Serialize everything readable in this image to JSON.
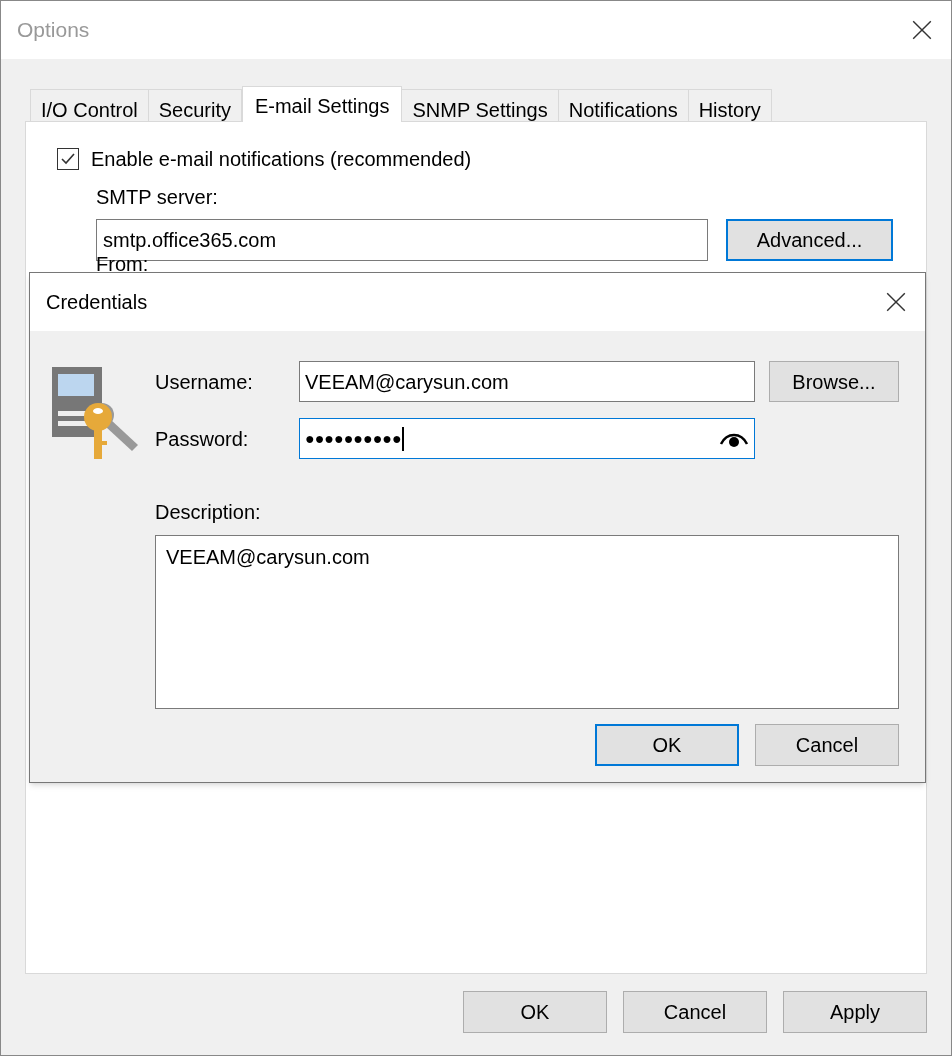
{
  "window": {
    "title": "Options"
  },
  "tabs": [
    {
      "label": "I/O Control",
      "selected": false
    },
    {
      "label": "Security",
      "selected": false
    },
    {
      "label": "E-mail Settings",
      "selected": true
    },
    {
      "label": "SNMP Settings",
      "selected": false
    },
    {
      "label": "Notifications",
      "selected": false
    },
    {
      "label": "History",
      "selected": false
    }
  ],
  "email": {
    "enable_label": "Enable e-mail notifications (recommended)",
    "enabled": true,
    "smtp_label": "SMTP server:",
    "smtp_value": "smtp.office365.com",
    "advanced_button": "Advanced...",
    "from_label": "From:"
  },
  "dialog": {
    "title": "Credentials",
    "username_label": "Username:",
    "username_value": "VEEAM@carysun.com",
    "browse_button": "Browse...",
    "password_label": "Password:",
    "password_value": "●●●●●●●●●●",
    "description_label": "Description:",
    "description_value": "VEEAM@carysun.com",
    "buttons": [
      "OK",
      "Cancel"
    ]
  },
  "buttons": [
    "OK",
    "Cancel",
    "Apply"
  ]
}
